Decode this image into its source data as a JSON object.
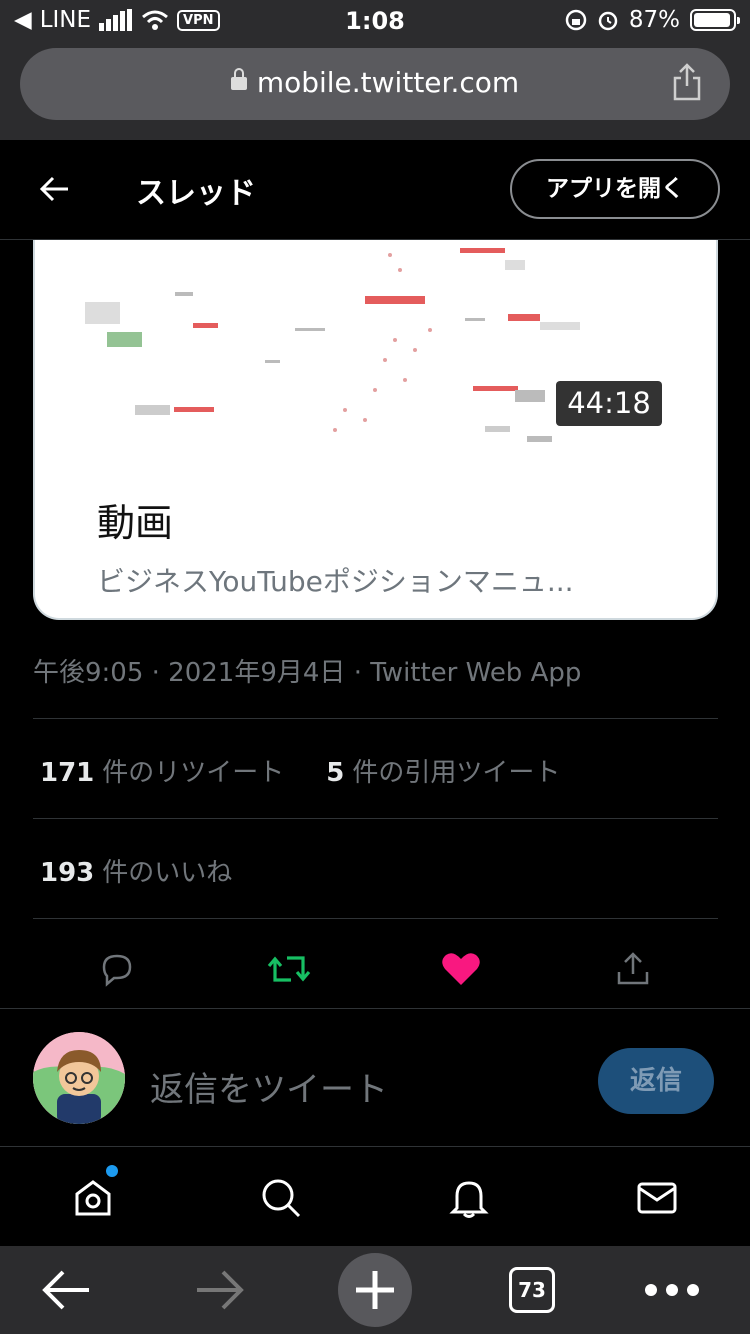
{
  "status_bar": {
    "back_app": "LINE",
    "vpn": "VPN",
    "time": "1:08",
    "battery": "87%"
  },
  "browser": {
    "url": "mobile.twitter.com",
    "tab_count": "73"
  },
  "header": {
    "title": "スレッド",
    "open_app_label": "アプリを開く"
  },
  "video_card": {
    "duration": "44:18",
    "title": "動画",
    "description": "ビジネスYouTubeポジションマニュ..."
  },
  "tweet_meta": {
    "timestamp": "午後9:05 · 2021年9月4日 · Twitter Web App"
  },
  "stats": {
    "retweets_count": "171",
    "retweets_label": "件のリツイート",
    "quotes_count": "5",
    "quotes_label": "件の引用ツイート",
    "likes_count": "193",
    "likes_label": "件のいいね"
  },
  "reply": {
    "placeholder": "返信をツイート",
    "button_label": "返信"
  },
  "colors": {
    "retweet_active": "#17bf63",
    "like_active": "#f91880",
    "accent": "#1d9bf0"
  },
  "icons": {
    "actions": [
      "reply-icon",
      "retweet-icon",
      "like-icon",
      "share-icon"
    ],
    "nav": [
      "home-icon",
      "search-icon",
      "notifications-icon",
      "messages-icon"
    ],
    "toolbar": [
      "back-arrow-icon",
      "forward-arrow-icon",
      "new-tab-plus-icon",
      "tabs-icon",
      "more-icon"
    ]
  }
}
